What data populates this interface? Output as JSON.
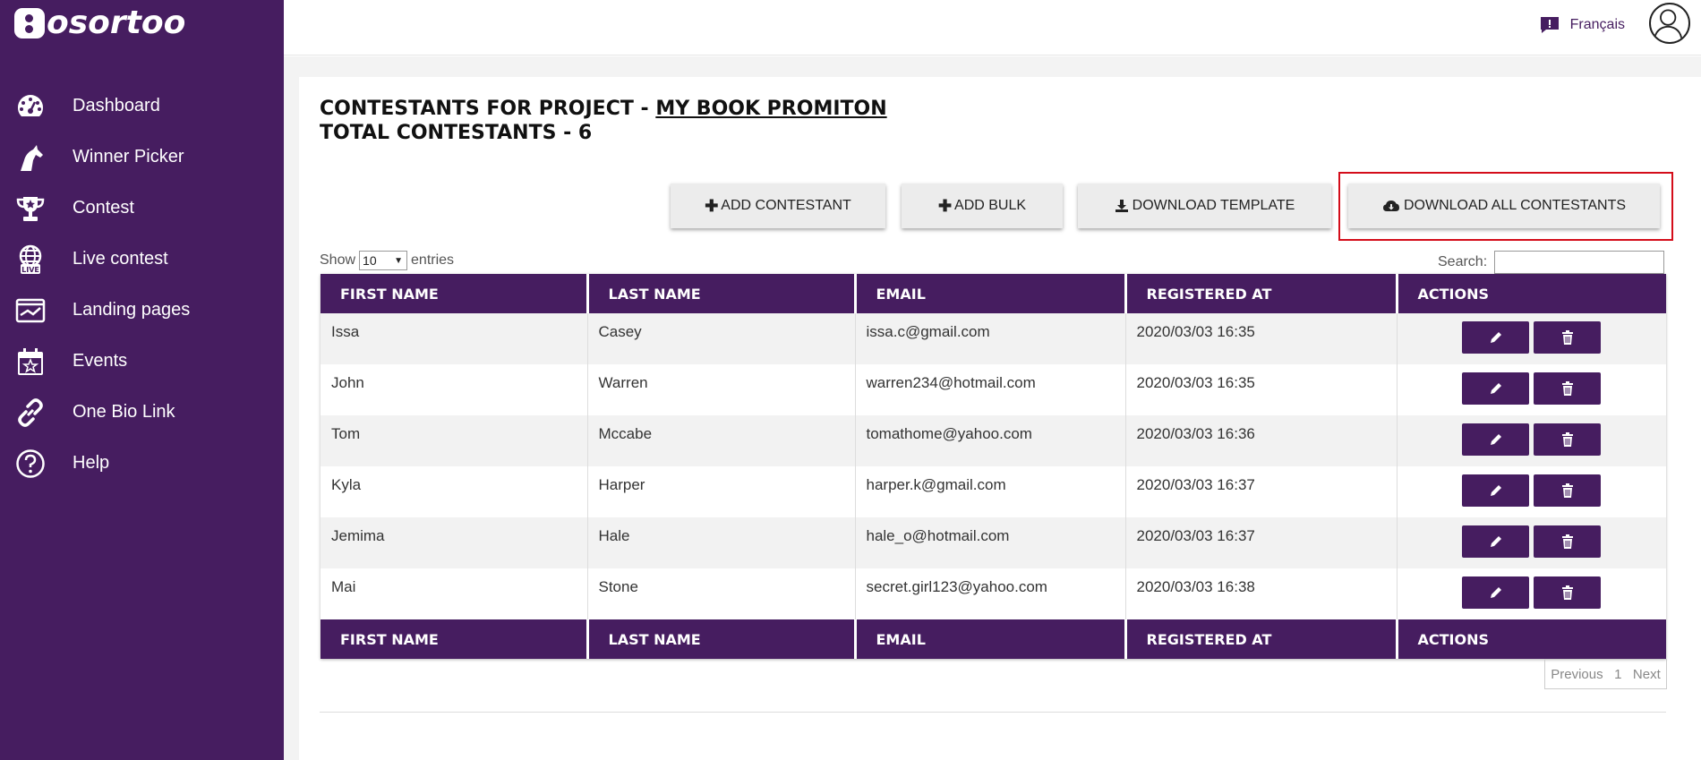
{
  "app": {
    "logo_text": "osortoo"
  },
  "sidebar": {
    "items": [
      {
        "label": "Dashboard",
        "icon": "dashboard-icon"
      },
      {
        "label": "Winner Picker",
        "icon": "horse-icon"
      },
      {
        "label": "Contest",
        "icon": "trophy-icon"
      },
      {
        "label": "Live contest",
        "icon": "live-globe-icon"
      },
      {
        "label": "Landing pages",
        "icon": "landing-page-icon"
      },
      {
        "label": "Events",
        "icon": "calendar-star-icon"
      },
      {
        "label": "One Bio Link",
        "icon": "link-icon"
      },
      {
        "label": "Help",
        "icon": "help-icon"
      }
    ]
  },
  "header": {
    "language": "Français"
  },
  "page": {
    "title_prefix": "CONTESTANTS FOR PROJECT - ",
    "project_name": "MY BOOK PROMITON",
    "total_line": "TOTAL CONTESTANTS - 6"
  },
  "toolbar": {
    "add_contestant": "ADD CONTESTANT",
    "add_bulk": "ADD BULK",
    "download_template": "DOWNLOAD TEMPLATE",
    "download_all": "DOWNLOAD ALL CONTESTANTS"
  },
  "table_controls": {
    "show_label": "Show",
    "entries_value": "10",
    "entries_label": "entries",
    "search_label": "Search:"
  },
  "table": {
    "columns": [
      "FIRST NAME",
      "LAST NAME",
      "EMAIL",
      "REGISTERED AT",
      "ACTIONS"
    ],
    "rows": [
      [
        "Issa",
        "Casey",
        "issa.c@gmail.com",
        "2020/03/03 16:35"
      ],
      [
        "John",
        "Warren",
        "warren234@hotmail.com",
        "2020/03/03 16:35"
      ],
      [
        "Tom",
        "Mccabe",
        "tomathome@yahoo.com",
        "2020/03/03 16:36"
      ],
      [
        "Kyla",
        "Harper",
        "harper.k@gmail.com",
        "2020/03/03 16:37"
      ],
      [
        "Jemima",
        "Hale",
        "hale_o@hotmail.com",
        "2020/03/03 16:37"
      ],
      [
        "Mai",
        "Stone",
        "secret.girl123@yahoo.com",
        "2020/03/03 16:38"
      ]
    ]
  },
  "pagination": {
    "previous": "Previous",
    "page": "1",
    "next": "Next"
  },
  "colors": {
    "brand": "#461d60",
    "highlight": "#d40d1a"
  }
}
